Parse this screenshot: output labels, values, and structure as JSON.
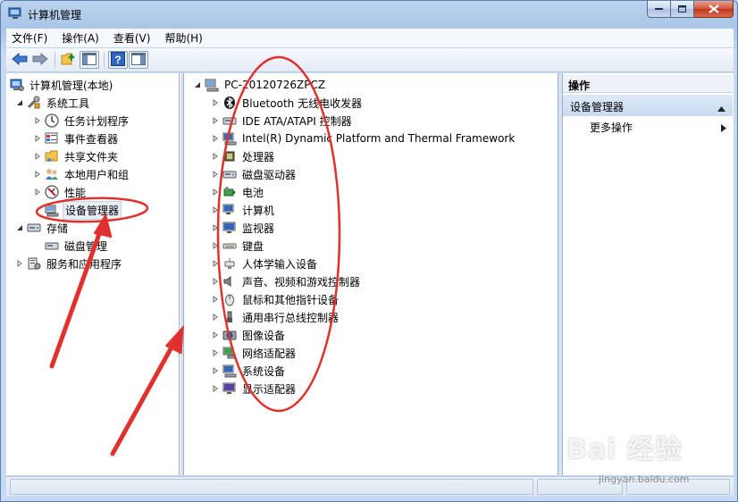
{
  "window": {
    "title": "计算机管理"
  },
  "menu": {
    "items": [
      "文件(F)",
      "操作(A)",
      "查看(V)",
      "帮助(H)"
    ]
  },
  "toolbar": {
    "icons": [
      "back-arrow-icon",
      "forward-arrow-icon",
      "up-folder-icon",
      "show-hide-tree-icon",
      "help-icon",
      "properties-icon"
    ]
  },
  "left_tree": {
    "root": "计算机管理(本地)",
    "items": [
      {
        "label": "系统工具",
        "level": 1,
        "expanded": true
      },
      {
        "label": "任务计划程序",
        "level": 2,
        "expanded": false
      },
      {
        "label": "事件查看器",
        "level": 2,
        "expanded": false
      },
      {
        "label": "共享文件夹",
        "level": 2,
        "expanded": false
      },
      {
        "label": "本地用户和组",
        "level": 2,
        "expanded": false
      },
      {
        "label": "性能",
        "level": 2,
        "expanded": false
      },
      {
        "label": "设备管理器",
        "level": 2,
        "selected": true
      },
      {
        "label": "存储",
        "level": 1,
        "expanded": true
      },
      {
        "label": "磁盘管理",
        "level": 2
      },
      {
        "label": "服务和应用程序",
        "level": 1,
        "expanded": false
      }
    ]
  },
  "device_tree": {
    "computer": "PC-20120726ZPCZ",
    "categories": [
      "Bluetooth 无线电收发器",
      "IDE ATA/ATAPI 控制器",
      "Intel(R) Dynamic Platform and Thermal Framework",
      "处理器",
      "磁盘驱动器",
      "电池",
      "计算机",
      "监视器",
      "键盘",
      "人体学输入设备",
      "声音、视频和游戏控制器",
      "鼠标和其他指针设备",
      "通用串行总线控制器",
      "图像设备",
      "网络适配器",
      "系统设备",
      "显示适配器"
    ]
  },
  "actions": {
    "header": "操作",
    "section": "设备管理器",
    "more": "更多操作"
  },
  "watermark": {
    "main": "Bai 经验",
    "sub": "jingyan.baidu.com"
  },
  "colors": {
    "annotation_red": "#e0312e",
    "window_frame": "#a9c5e8",
    "selection": "#cce8ff"
  }
}
